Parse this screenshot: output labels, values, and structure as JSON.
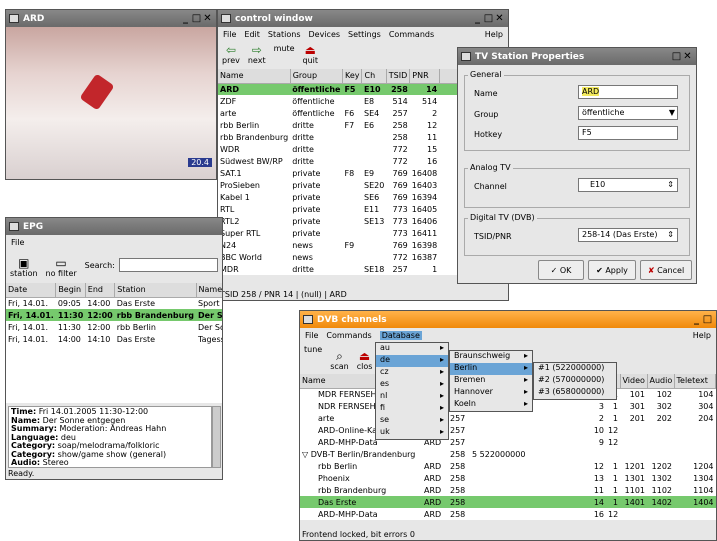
{
  "ard": {
    "title": "ARD",
    "time": "20.4"
  },
  "control": {
    "title": "control window",
    "menu": [
      "File",
      "Edit",
      "Stations",
      "Devices",
      "Settings",
      "Commands",
      "Help"
    ],
    "toolbar": {
      "prev": "prev",
      "next": "next",
      "mute": "mute",
      "quit": "quit"
    },
    "cols": [
      "Name",
      "Group",
      "Key",
      "Ch",
      "TSID",
      "PNR"
    ],
    "rows": [
      [
        "ARD",
        "öffentliche",
        "F5",
        "E10",
        "258",
        "14"
      ],
      [
        "ZDF",
        "öffentliche",
        "",
        "E8",
        "514",
        "514"
      ],
      [
        "arte",
        "öffentliche",
        "F6",
        "SE4",
        "257",
        "2"
      ],
      [
        "rbb Berlin",
        "dritte",
        "F7",
        "E6",
        "258",
        "12"
      ],
      [
        "rbb Brandenburg",
        "dritte",
        "",
        "",
        "258",
        "11"
      ],
      [
        "WDR",
        "dritte",
        "",
        "",
        "772",
        "15"
      ],
      [
        "Südwest BW/RP",
        "dritte",
        "",
        "",
        "772",
        "16"
      ],
      [
        "SAT.1",
        "private",
        "F8",
        "E9",
        "769",
        "16408"
      ],
      [
        "ProSieben",
        "private",
        "",
        "SE20",
        "769",
        "16403"
      ],
      [
        "Kabel 1",
        "private",
        "",
        "SE6",
        "769",
        "16394"
      ],
      [
        "RTL",
        "private",
        "",
        "E11",
        "773",
        "16405"
      ],
      [
        "RTL2",
        "private",
        "",
        "SE13",
        "773",
        "16406"
      ],
      [
        "Super RTL",
        "private",
        "",
        "",
        "773",
        "16411"
      ],
      [
        "N24",
        "news",
        "F9",
        "",
        "769",
        "16398"
      ],
      [
        "BBC World",
        "news",
        "",
        "",
        "772",
        "16387"
      ],
      [
        "MDR",
        "dritte",
        "",
        "SE18",
        "257",
        "1"
      ]
    ],
    "status": "TSID 258 / PNR 14 | (null) | ARD"
  },
  "props": {
    "title": "TV Station Properties",
    "general": "General",
    "name_l": "Name",
    "name_v": "ARD",
    "group_l": "Group",
    "group_v": "öffentliche",
    "hotkey_l": "Hotkey",
    "hotkey_v": "F5",
    "analog": "Analog TV",
    "channel_l": "Channel",
    "channel_v": "E10",
    "dvb": "Digital TV (DVB)",
    "tsid_l": "TSID/PNR",
    "tsid_v": "258-14 (Das Erste)",
    "ok": "OK",
    "apply": "Apply",
    "cancel": "Cancel"
  },
  "epg": {
    "title": "EPG",
    "menu_file": "File",
    "station": "station",
    "nofilter": "no filter",
    "search": "Search:",
    "cols": [
      "Date",
      "Begin",
      "End",
      "Station",
      "Name"
    ],
    "rows": [
      [
        "Fri, 14.01.",
        "09:05",
        "14:00",
        "Das Erste",
        "Sport"
      ],
      [
        "Fri, 14.01.",
        "11:30",
        "12:00",
        "rbb Brandenburg",
        "Der Sonne entgegen"
      ],
      [
        "Fri, 14.01.",
        "11:30",
        "12:00",
        "rbb Berlin",
        "Der Sonne entgegen"
      ],
      [
        "Fri, 14.01.",
        "14:00",
        "14:10",
        "Das Erste",
        "Tagesschau"
      ]
    ],
    "details": [
      [
        "Time:",
        "Fri 14.01.2005 11:30-12:00"
      ],
      [
        "Name:",
        "Der Sonne entgegen"
      ],
      [
        "Summary:",
        "Moderation: Andreas Hahn"
      ],
      [
        "Language:",
        "deu"
      ],
      [
        "Category:",
        "soap/melodrama/folkloric"
      ],
      [
        "Category:",
        "show/game show (general)"
      ],
      [
        "Audio:",
        "Stereo"
      ]
    ],
    "status": "Ready."
  },
  "dvb": {
    "title": "DVB channels",
    "menu": [
      "File",
      "Commands",
      "Database"
    ],
    "help": "Help",
    "tune": "tune",
    "scan": "scan",
    "close": "clos",
    "cols": [
      "Name",
      "",
      "",
      "",
      "",
      "Video",
      "Audio",
      "Teletext"
    ],
    "rows": [
      [
        "MDR FERNSEH",
        "",
        "",
        "",
        "",
        "1",
        "101",
        "102",
        "104"
      ],
      [
        "NDR FERNSEH",
        "",
        "",
        "",
        "3",
        "1",
        "301",
        "302",
        "304"
      ],
      [
        "arte",
        "",
        "257",
        "",
        "2",
        "1",
        "201",
        "202",
        "204"
      ],
      [
        "ARD-Online-Kanal",
        "ARD",
        "257",
        "",
        "10",
        "12",
        "",
        "",
        ""
      ],
      [
        "ARD-MHP-Data",
        "ARD",
        "257",
        "",
        "9",
        "12",
        "",
        "",
        ""
      ],
      [
        "▽ DVB-T Berlin/Brandenburg",
        "",
        "258",
        "5 522000000",
        "",
        "",
        "",
        "",
        ""
      ],
      [
        "rbb Berlin",
        "ARD",
        "258",
        "",
        "12",
        "1",
        "1201",
        "1202",
        "1204"
      ],
      [
        "Phoenix",
        "ARD",
        "258",
        "",
        "13",
        "1",
        "1301",
        "1302",
        "1304"
      ],
      [
        "rbb Brandenburg",
        "ARD",
        "258",
        "",
        "11",
        "1",
        "1101",
        "1102",
        "1104"
      ],
      [
        "Das Erste",
        "ARD",
        "258",
        "",
        "14",
        "1",
        "1401",
        "1402",
        "1404"
      ],
      [
        "ARD-MHP-Data",
        "ARD",
        "258",
        "",
        "16",
        "12",
        "",
        "",
        ""
      ]
    ],
    "status": "Frontend locked, bit errors 0",
    "db_menu": [
      "au",
      "de",
      "cz",
      "es",
      "nl",
      "fi",
      "se",
      "uk"
    ],
    "de_menu": [
      "Braunschweig",
      "Berlin",
      "Bremen",
      "Hannover",
      "Koeln"
    ],
    "berlin_menu": [
      "#1 (522000000)",
      "#2 (570000000)",
      "#3 (658000000)"
    ]
  }
}
